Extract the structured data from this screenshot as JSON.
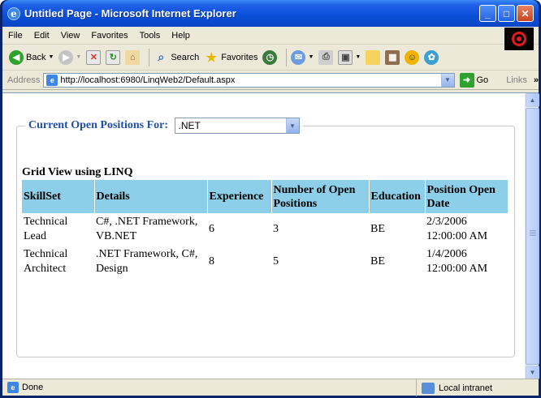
{
  "window": {
    "title": "Untitled Page - Microsoft Internet Explorer"
  },
  "menu": [
    "File",
    "Edit",
    "View",
    "Favorites",
    "Tools",
    "Help"
  ],
  "toolbar": {
    "back": "Back",
    "search": "Search",
    "favorites": "Favorites"
  },
  "address": {
    "label": "Address",
    "url": "http://localhost:6980/LinqWeb2/Default.aspx",
    "go": "Go",
    "links": "Links"
  },
  "page": {
    "legend": "Current Open Positions For:",
    "selected_option": ".NET",
    "grid_title": "Grid View using LINQ",
    "headers": [
      "SkillSet",
      "Details",
      "Experience",
      "Number of Open Positions",
      "Education",
      "Position Open Date"
    ],
    "rows": [
      [
        "Technical Lead",
        "C#, .NET Framework, VB.NET",
        "6",
        "3",
        "BE",
        "2/3/2006 12:00:00 AM"
      ],
      [
        "Technical Architect",
        ".NET Framework, C#, Design",
        "8",
        "5",
        "BE",
        "1/4/2006 12:00:00 AM"
      ]
    ]
  },
  "status": {
    "text": "Done",
    "zone": "Local intranet"
  }
}
